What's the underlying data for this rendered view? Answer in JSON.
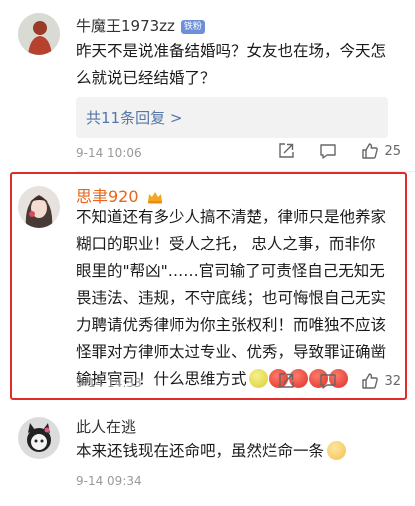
{
  "comments": [
    {
      "username": "牛魔王1973zz",
      "badge": "铁粉",
      "lines": [
        "昨天不是说准备结婚吗？女友也在场，今天怎",
        "么就说已经结婚了？"
      ],
      "reply_link": "共11条回复 >",
      "time": "9-14 10:06",
      "like_count": "25"
    },
    {
      "username": "思聿920",
      "lines": [
        "不知道还有多少人搞不清楚，律师只是他养家",
        "糊口的职业！受人之托， 忠人之事，而非你",
        "眼里的\"帮凶\"……官司输了可责怪自己无知无",
        "畏违法、违规，不守底线；也可悔恨自己无实",
        "力聘请优秀律师为你主张权利！而唯独不应该",
        "怪罪对方律师太过专业、优秀，导致罪证确凿",
        "输掉官司！什么思维方式"
      ],
      "time": "9-14 14:33",
      "like_count": "32"
    },
    {
      "username": "此人在逃",
      "lines": [
        "本来还钱现在还命吧，虽然烂命一条"
      ],
      "time": "9-14 09:34"
    }
  ],
  "colors": {
    "highlight": "#e12a2a",
    "username_highlight": "#e8651a",
    "link": "#5576a8"
  },
  "icons": [
    "share-icon",
    "comment-icon",
    "like-icon",
    "vip-crown-icon",
    "lemon-emoji",
    "angry-emoji",
    "sweat-emoji"
  ]
}
